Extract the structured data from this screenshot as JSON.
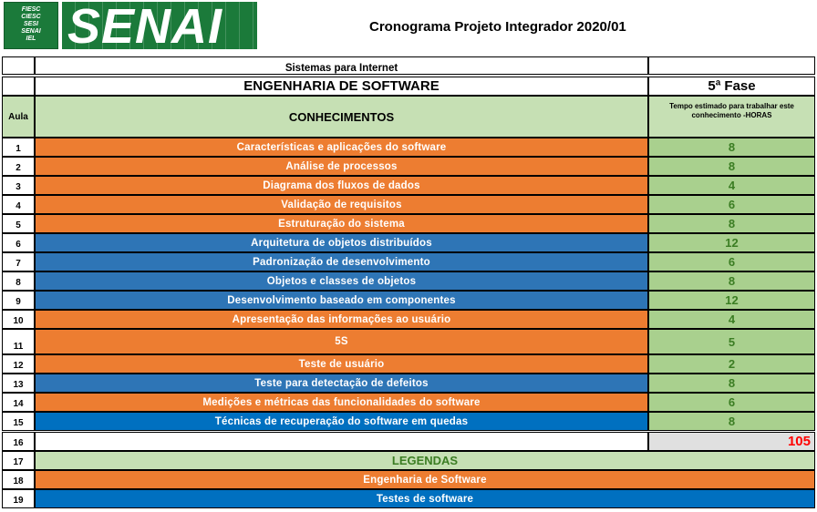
{
  "header": {
    "logo_small_lines": [
      "FIESC",
      "CIESC",
      "SESI",
      "SENAI",
      "IEL"
    ],
    "logo_big_text": "SENAI",
    "title": "Cronograma Projeto Integrador 2020/01"
  },
  "course": {
    "program": "Sistemas para Internet",
    "subject": "ENGENHARIA DE SOFTWARE",
    "phase": "5ª Fase"
  },
  "columns": {
    "aula": "Aula",
    "conhecimentos": "CONHECIMENTOS",
    "tempo": "Tempo estimado para trabalhar este conhecimento -HORAS"
  },
  "rows": [
    {
      "aula": "1",
      "topic": "Características e aplicações do software",
      "hours": "8",
      "color": "#ed7d31"
    },
    {
      "aula": "2",
      "topic": "Análise de processos",
      "hours": "8",
      "color": "#ed7d31"
    },
    {
      "aula": "3",
      "topic": "Diagrama dos fluxos de dados",
      "hours": "4",
      "color": "#ed7d31"
    },
    {
      "aula": "4",
      "topic": "Validação de requisitos",
      "hours": "6",
      "color": "#ed7d31"
    },
    {
      "aula": "5",
      "topic": "Estruturação do sistema",
      "hours": "8",
      "color": "#ed7d31"
    },
    {
      "aula": "6",
      "topic": "Arquitetura de objetos distribuídos",
      "hours": "12",
      "color": "#2e75b6"
    },
    {
      "aula": "7",
      "topic": "Padronização de desenvolvimento",
      "hours": "6",
      "color": "#2e75b6"
    },
    {
      "aula": "8",
      "topic": "Objetos e classes de objetos",
      "hours": "8",
      "color": "#2e75b6"
    },
    {
      "aula": "9",
      "topic": "Desenvolvimento baseado em componentes",
      "hours": "12",
      "color": "#2e75b6"
    },
    {
      "aula": "10",
      "topic": "Apresentação das informações ao usuário",
      "hours": "4",
      "color": "#ed7d31"
    },
    {
      "aula": "11",
      "topic": "5S",
      "hours": "5",
      "color": "#ed7d31"
    },
    {
      "aula": "12",
      "topic": "Teste de usuário",
      "hours": "2",
      "color": "#ed7d31"
    },
    {
      "aula": "13",
      "topic": "Teste para detectação de defeitos",
      "hours": "8",
      "color": "#2e75b6"
    },
    {
      "aula": "14",
      "topic": "Medições e métricas das funcionalidades do software",
      "hours": "6",
      "color": "#ed7d31"
    },
    {
      "aula": "15",
      "topic": "Técnicas de recuperação do software em quedas",
      "hours": "8",
      "color": "#0070c0"
    }
  ],
  "total": {
    "aula": "16",
    "hours": "105",
    "color": "#ff0000"
  },
  "legend": {
    "aula": "17",
    "title": "LEGENDAS",
    "items": [
      {
        "aula": "18",
        "label": "Engenharia de Software",
        "color": "#ed7d31"
      },
      {
        "aula": "19",
        "label": "Testes de software",
        "color": "#0070c0"
      }
    ]
  }
}
